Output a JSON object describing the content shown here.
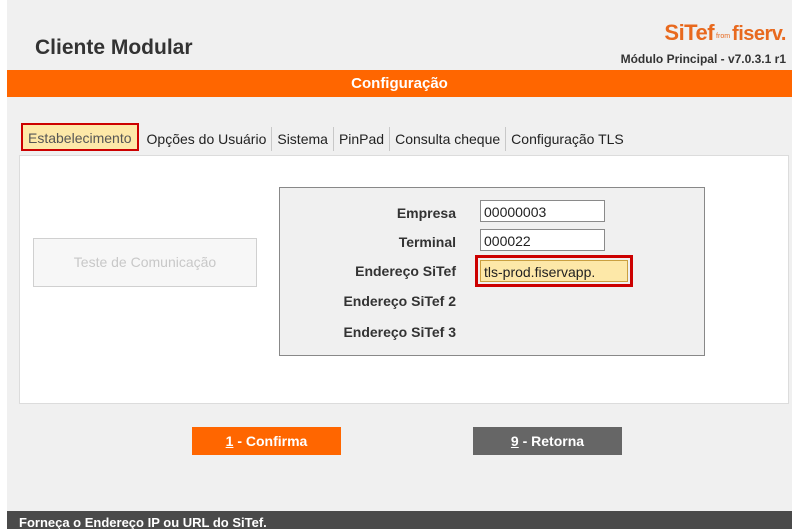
{
  "header": {
    "title": "Cliente Modular",
    "brand": {
      "name": "SiTef",
      "from": "from",
      "partner": "fiserv."
    },
    "version": "Módulo Principal - v7.0.3.1 r1"
  },
  "banner": {
    "title": "Configuração"
  },
  "tabs": [
    {
      "label": "Estabelecimento",
      "active": true
    },
    {
      "label": "Opções do Usuário"
    },
    {
      "label": "Sistema"
    },
    {
      "label": "PinPad"
    },
    {
      "label": "Consulta cheque"
    },
    {
      "label": "Configuração TLS"
    }
  ],
  "test_button": {
    "label": "Teste de Comunicação"
  },
  "form": {
    "empresa": {
      "label": "Empresa",
      "value": "00000003"
    },
    "terminal": {
      "label": "Terminal",
      "value": "000022"
    },
    "endereco1": {
      "label": "Endereço SiTef",
      "value": "tls-prod.fiservapp."
    },
    "endereco2": {
      "label": "Endereço SiTef 2"
    },
    "endereco3": {
      "label": "Endereço SiTef 3"
    }
  },
  "buttons": {
    "confirm": {
      "key": "1",
      "label": " - Confirma"
    },
    "return": {
      "key": "9",
      "label": " - Retorna"
    }
  },
  "status": {
    "message": "Forneça o Endereço IP ou URL do SiTef."
  },
  "colors": {
    "accent": "#ff6600",
    "highlight": "#fde8a8",
    "annotation": "#cc0000",
    "status_bar": "#4a4a4a"
  }
}
